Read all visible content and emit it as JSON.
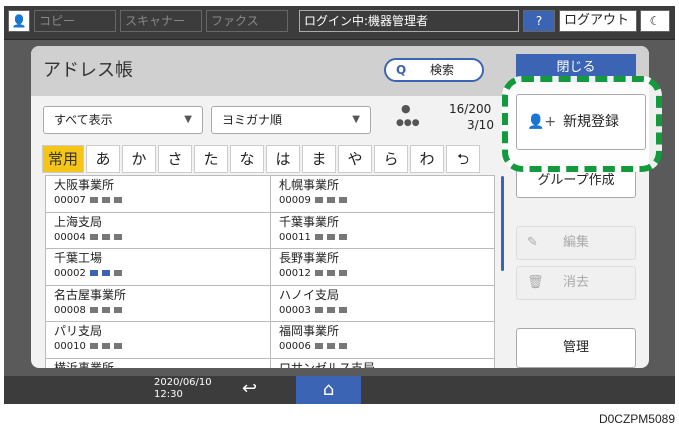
{
  "topbar": {
    "copy": "コピー",
    "scanner": "スキャナー",
    "fax": "ファクス",
    "login_status": "ログイン中:機器管理者",
    "help": "?",
    "logout": "ログアウト",
    "energy": "☾"
  },
  "header": {
    "title": "アドレス帳",
    "search": "検索",
    "close": "閉じる"
  },
  "filters": {
    "display": "すべて表示",
    "sort": "ヨミガナ順",
    "user_count": "16/200",
    "group_count": "3/10"
  },
  "tabs": [
    "常用",
    "あ",
    "か",
    "さ",
    "た",
    "な",
    "は",
    "ま",
    "や",
    "ら",
    "わ",
    "⮌"
  ],
  "entries": [
    [
      {
        "name": "大阪事業所",
        "num": "00007"
      },
      {
        "name": "札幌事業所",
        "num": "00009"
      }
    ],
    [
      {
        "name": "上海支局",
        "num": "00004"
      },
      {
        "name": "千葉事業所",
        "num": "00011"
      }
    ],
    [
      {
        "name": "千葉工場",
        "num": "00002",
        "selected": true
      },
      {
        "name": "長野事業所",
        "num": "00012"
      }
    ],
    [
      {
        "name": "名古屋事業所",
        "num": "00008"
      },
      {
        "name": "ハノイ支局",
        "num": "00003"
      }
    ],
    [
      {
        "name": "パリ支局",
        "num": "00010"
      },
      {
        "name": "福岡事業所",
        "num": "00006"
      }
    ],
    [
      {
        "name": "横浜事業所",
        "num": ""
      },
      {
        "name": "ロサンゼルス支局",
        "num": ""
      }
    ]
  ],
  "actions": {
    "new": "新規登録",
    "group": "グループ作成",
    "edit": "編集",
    "delete": "消去",
    "manage": "管理"
  },
  "bottom": {
    "date": "2020/06/10",
    "time": "12:30"
  },
  "caption": "D0CZPM5089",
  "colors": {
    "accent": "#3c64b4",
    "highlight": "#129a3c",
    "active_tab": "#f5c518"
  }
}
